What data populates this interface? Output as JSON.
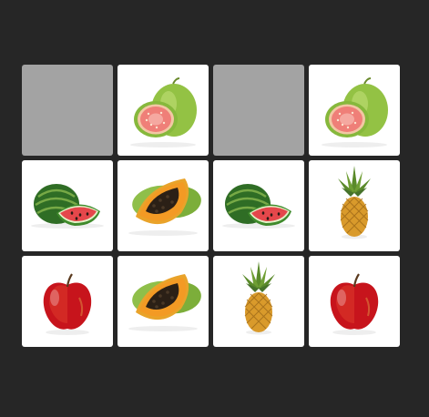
{
  "colors": {
    "background": "#262626",
    "card_face_down": "#a3a3a3",
    "card_face_up": "#ffffff"
  },
  "board": {
    "columns": 4,
    "rows": 3,
    "cards": [
      {
        "state": "face-down",
        "fruit": null
      },
      {
        "state": "face-up",
        "fruit": "guava"
      },
      {
        "state": "face-down",
        "fruit": null
      },
      {
        "state": "face-up",
        "fruit": "guava"
      },
      {
        "state": "face-up",
        "fruit": "watermelon"
      },
      {
        "state": "face-up",
        "fruit": "papaya"
      },
      {
        "state": "face-up",
        "fruit": "watermelon"
      },
      {
        "state": "face-up",
        "fruit": "pineapple"
      },
      {
        "state": "face-up",
        "fruit": "apple"
      },
      {
        "state": "face-up",
        "fruit": "papaya"
      },
      {
        "state": "face-up",
        "fruit": "pineapple"
      },
      {
        "state": "face-up",
        "fruit": "apple"
      }
    ]
  }
}
